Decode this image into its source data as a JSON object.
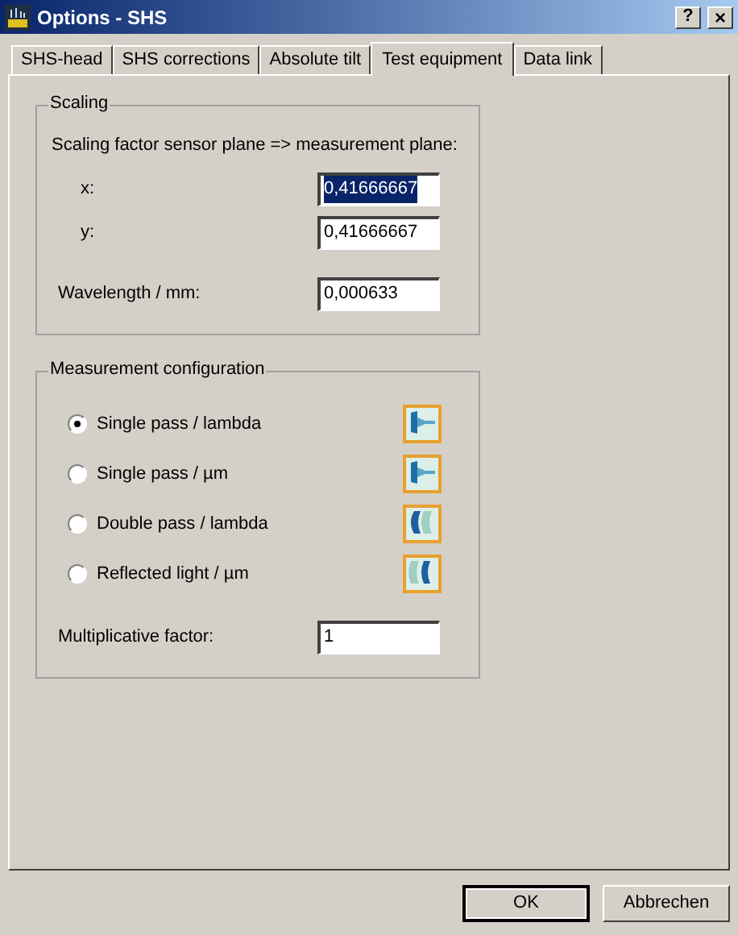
{
  "window": {
    "title": "Options - SHS",
    "help_button": "?",
    "close_button": "×"
  },
  "tabs": [
    {
      "label": "SHS-head",
      "selected": false
    },
    {
      "label": "SHS corrections",
      "selected": false
    },
    {
      "label": "Absolute tilt",
      "selected": false
    },
    {
      "label": "Test equipment",
      "selected": true
    },
    {
      "label": "Data link",
      "selected": false
    }
  ],
  "scaling": {
    "title": "Scaling",
    "description": "Scaling factor sensor plane => measurement plane:",
    "fields": [
      {
        "label": "x:",
        "value": "0,41666667",
        "text_selected": true
      },
      {
        "label": "y:",
        "value": "0,41666667",
        "text_selected": false
      }
    ],
    "wavelength": {
      "label": "Wavelength / mm:",
      "value": "0,000633"
    }
  },
  "measurement_configuration": {
    "title": "Measurement configuration",
    "options": [
      {
        "label": "Single pass / lambda",
        "selected": true,
        "kind": "single"
      },
      {
        "label": "Single pass / µm",
        "selected": false,
        "kind": "single"
      },
      {
        "label": "Double pass / lambda",
        "selected": false,
        "kind": "double"
      },
      {
        "label": "Reflected light / µm",
        "selected": false,
        "kind": "reflected"
      }
    ],
    "factor": {
      "label": "Multiplicative factor:",
      "value": "1"
    }
  },
  "buttons": [
    {
      "label": "OK",
      "default": true
    },
    {
      "label": "Abbrechen",
      "default": false
    }
  ]
}
